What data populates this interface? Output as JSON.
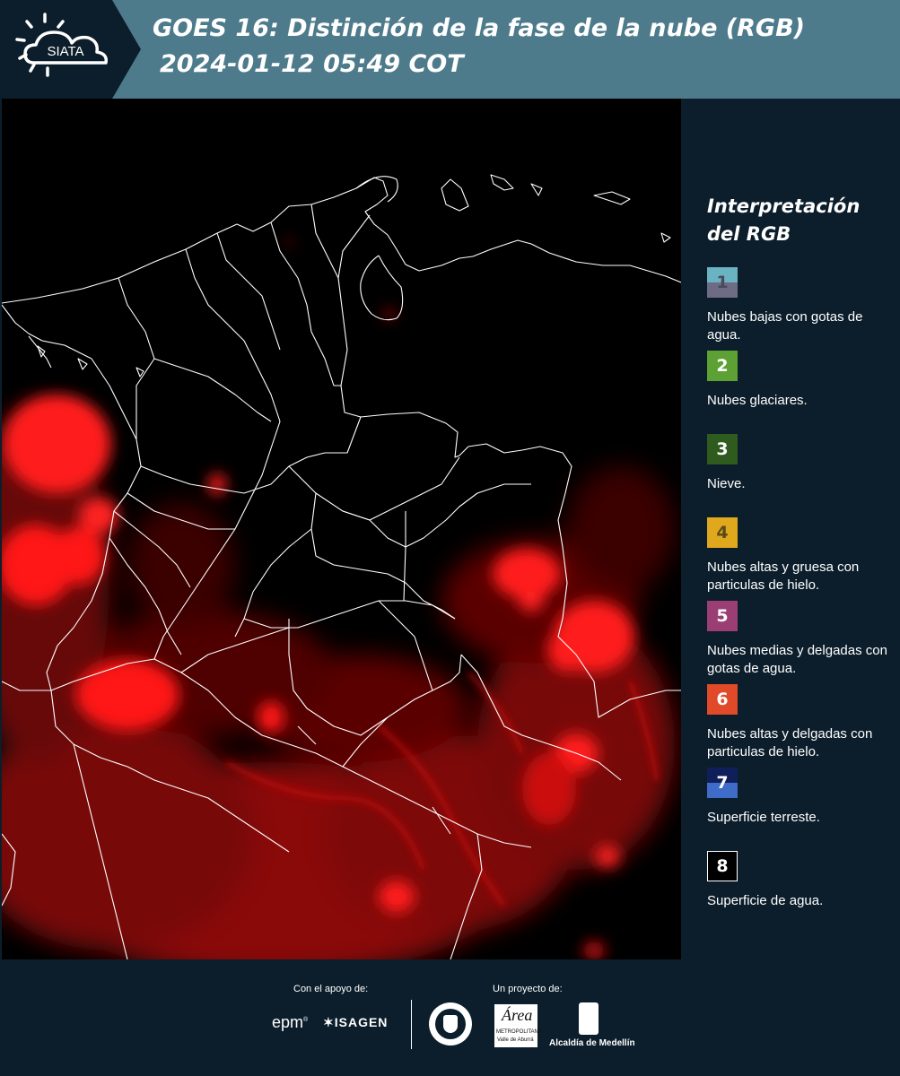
{
  "header": {
    "brand": "SIATA",
    "title_line1": "GOES 16: Distinción de la fase de la nube (RGB)",
    "title_line2": "2024-01-12 05:49 COT"
  },
  "legend": {
    "title": "Interpretación del RGB",
    "items": [
      {
        "number": "1",
        "label": "Nubes bajas con gotas de agua.",
        "color_top": "#6ab3c3",
        "color_bottom": "#6e6b85",
        "text_color": "#4a4a5a"
      },
      {
        "number": "2",
        "label": "Nubes glaciares.",
        "color_top": "#5da033",
        "color_bottom": "#5da033",
        "text_color": "#ffffff"
      },
      {
        "number": "3",
        "label": "Nieve.",
        "color_top": "#2f5c1e",
        "color_bottom": "#2f5c1e",
        "text_color": "#ffffff"
      },
      {
        "number": "4",
        "label": "Nubes altas y gruesa con particulas de hielo.",
        "color_top": "#e0a81c",
        "color_bottom": "#e0a81c",
        "text_color": "#5a4a1a"
      },
      {
        "number": "5",
        "label": "Nubes medias y delgadas con gotas de agua.",
        "color_top": "#9b3e74",
        "color_bottom": "#9b3e74",
        "text_color": "#ffffff"
      },
      {
        "number": "6",
        "label": "Nubes altas y delgadas con particulas de hielo.",
        "color_top": "#e04a28",
        "color_bottom": "#e04a28",
        "text_color": "#ffffff"
      },
      {
        "number": "7",
        "label": "Superficie terreste.",
        "color_top": "#0e1f5a",
        "color_bottom": "#3f6bc9",
        "text_color": "#ffffff"
      },
      {
        "number": "8",
        "label": "Superficie de agua.",
        "color_top": "#000000",
        "color_bottom": "#000000",
        "text_color": "#ffffff"
      }
    ]
  },
  "footer": {
    "support_label": "Con el apoyo de:",
    "project_label": "Un proyecto de:",
    "sponsor_epm": "epm",
    "sponsor_isagen": "ISAGEN",
    "partner_area": "Área",
    "partner_area_sub": "METROPOLITANA",
    "partner_area_sub2": "Valle de Aburrá",
    "partner_alcaldia": "Alcaldía de Medellín"
  },
  "colors": {
    "header_bg": "#4d7b8c",
    "header_dark": "#0c1e2b",
    "panel_bg": "#0c1e2b",
    "cloud_red": "#ff1a1a",
    "borders": "#ffffff"
  }
}
